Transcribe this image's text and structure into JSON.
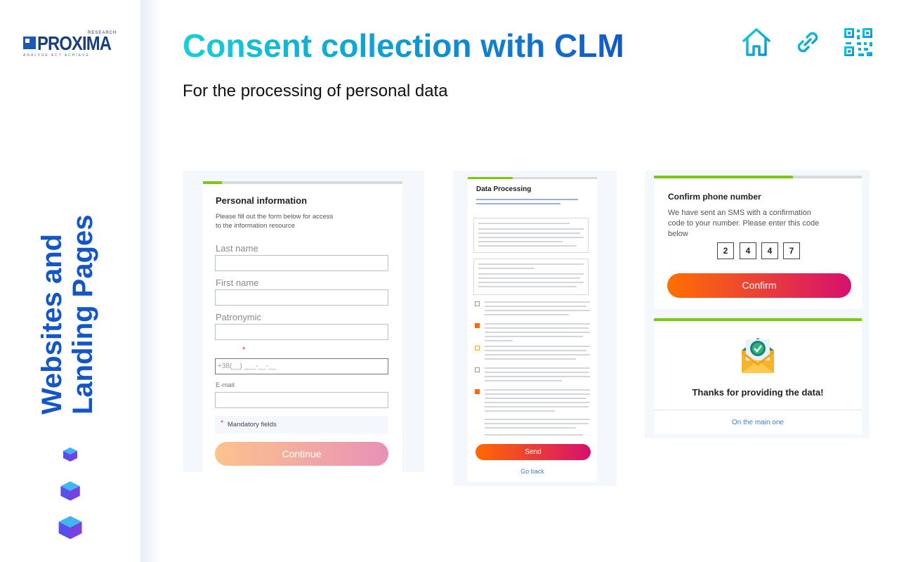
{
  "brand": {
    "name": "PROXIMA",
    "superscript": "RESEARCH",
    "tagline": "ANALYSE  ACT  ACHIEVE"
  },
  "sidebar": {
    "vertical_title_line1": "Websites and",
    "vertical_title_line2": "Landing Pages"
  },
  "header": {
    "title": "Consent collection with CLM",
    "subtitle": "For the processing of personal data",
    "icons": [
      "home-icon",
      "link-icon",
      "qr-code-icon"
    ]
  },
  "form_personal": {
    "title": "Personal information",
    "description": "Please fill out the form below for access to the information resource",
    "fields": {
      "last_name": "Last name",
      "first_name": "First name",
      "patronymic": "Patronymic",
      "phone_placeholder": "+38(__) ___-__-__",
      "email": "E-mail"
    },
    "required_star": "*",
    "mandatory_note": "Mandatory fields",
    "continue_label": "Continue",
    "progress": 0.1
  },
  "form_data_processing": {
    "title": "Data Processing",
    "send_label": "Send",
    "back_label": "Go back",
    "progress": 0.35
  },
  "form_confirm": {
    "title": "Confirm phone number",
    "description": "We have sent an SMS with a confirmation code to your number. Please enter this code below",
    "code": [
      "2",
      "4",
      "4",
      "7"
    ],
    "confirm_label": "Confirm",
    "progress": 0.65
  },
  "form_thanks": {
    "message": "Thanks for providing the data!",
    "main_link": "On the main one",
    "progress": 1.0
  },
  "colors": {
    "brand_blue": "#1456c8",
    "accent_cyan": "#17d0d8",
    "progress_green": "#7cc70f",
    "button_orange": "#ff6a00",
    "button_pink": "#d6106e"
  }
}
